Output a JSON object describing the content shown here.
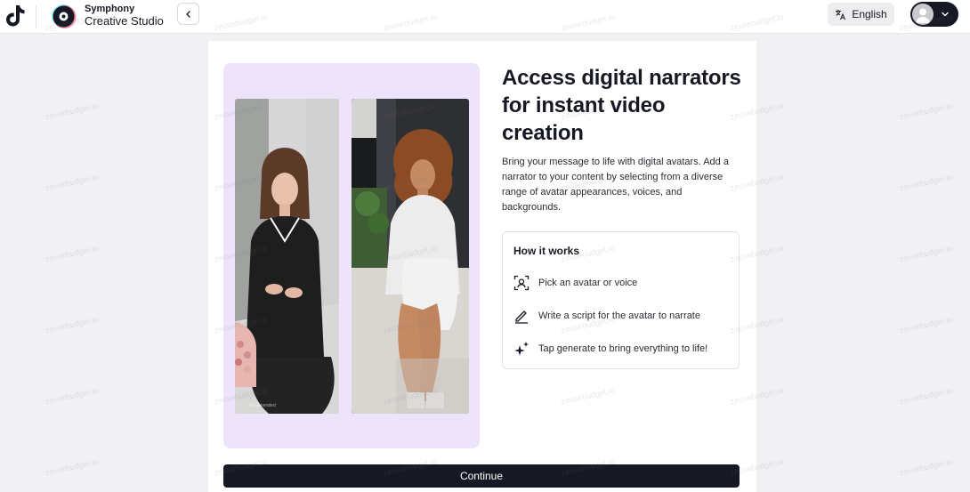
{
  "header": {
    "brand_line1": "Symphony",
    "brand_line2": "Creative Studio",
    "back_icon": "chevron-left-icon",
    "language": {
      "icon": "translate-icon",
      "label": "English"
    },
    "user_menu": {
      "avatar_icon": "user-avatar-icon",
      "chevron_icon": "chevron-down-icon"
    }
  },
  "main": {
    "title": "Access digital narrators for instant video creation",
    "description": "Bring your message to life with digital avatars. Add a narrator to your content by selecting from a diverse range of avatar appearances, voices, and backgrounds.",
    "video_caption": "AI Generated",
    "how_it_works": {
      "title": "How it works",
      "steps": [
        {
          "icon": "avatar-select-icon",
          "text": "Pick an avatar or voice"
        },
        {
          "icon": "pencil-icon",
          "text": "Write a script for the avatar to narrate"
        },
        {
          "icon": "sparkle-icon",
          "text": "Tap generate to bring everything to life!"
        }
      ]
    },
    "continue_label": "Continue"
  },
  "watermark": "zeusebudget.io",
  "colors": {
    "panel_bg": "#ede4fb",
    "primary_dark": "#161823",
    "page_bg": "#f1f1f3"
  }
}
